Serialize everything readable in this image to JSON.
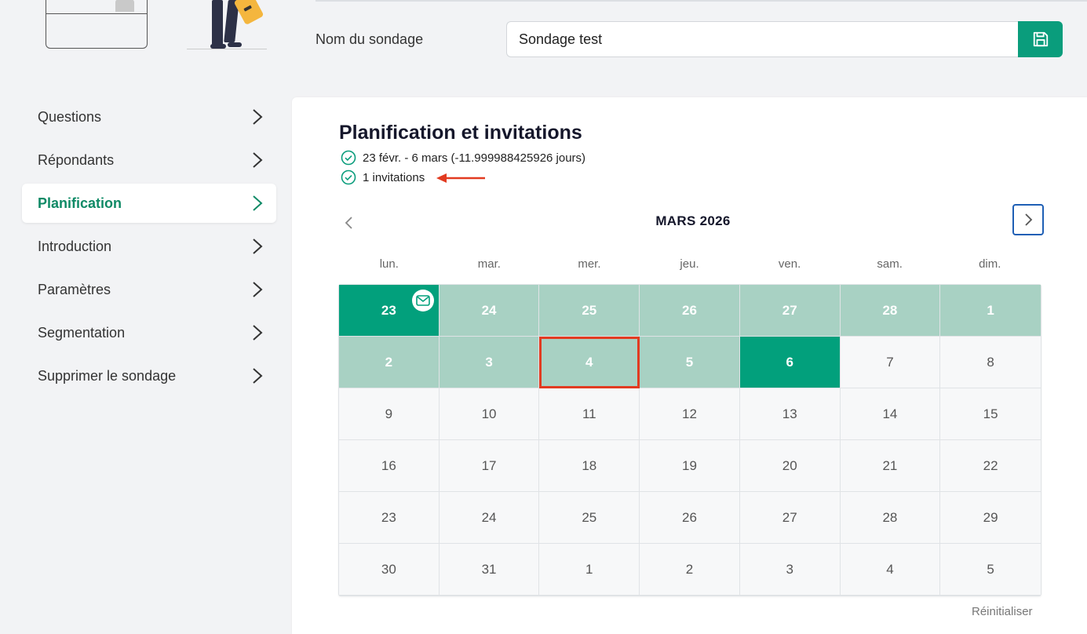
{
  "header": {
    "survey_name_label": "Nom du sondage",
    "survey_name_value": "Sondage test",
    "save_icon": "floppy-disk-icon"
  },
  "sidebar": {
    "items": [
      {
        "label": "Questions",
        "active": false
      },
      {
        "label": "Répondants",
        "active": false
      },
      {
        "label": "Planification",
        "active": true
      },
      {
        "label": "Introduction",
        "active": false
      },
      {
        "label": "Paramètres",
        "active": false
      },
      {
        "label": "Segmentation",
        "active": false
      },
      {
        "label": "Supprimer le sondage",
        "active": false
      }
    ]
  },
  "main": {
    "title": "Planification et invitations",
    "date_range_text": "23 févr. - 6 mars (-11.999988425926 jours)",
    "invitations_text": "1 invitations",
    "calendar": {
      "month_label": "MARS 2026",
      "weekdays": [
        "lun.",
        "mar.",
        "mer.",
        "jeu.",
        "ven.",
        "sam.",
        "dim."
      ],
      "weeks": [
        [
          "23",
          "24",
          "25",
          "26",
          "27",
          "28",
          "1"
        ],
        [
          "2",
          "3",
          "4",
          "5",
          "6",
          "7",
          "8"
        ],
        [
          "9",
          "10",
          "11",
          "12",
          "13",
          "14",
          "15"
        ],
        [
          "16",
          "17",
          "18",
          "19",
          "20",
          "21",
          "22"
        ],
        [
          "23",
          "24",
          "25",
          "26",
          "27",
          "28",
          "29"
        ],
        [
          "30",
          "31",
          "1",
          "2",
          "3",
          "4",
          "5"
        ]
      ],
      "range_start": "23",
      "range_end": "6",
      "selected_day": "4",
      "invitation_day": "23"
    },
    "reset_label": "Réinitialiser"
  },
  "colors": {
    "brand_green": "#02a07c",
    "range_green": "#a8d1c3",
    "active_text": "#0f8a66",
    "highlight_red": "#e23b21",
    "focus_blue": "#1f5fb5"
  }
}
